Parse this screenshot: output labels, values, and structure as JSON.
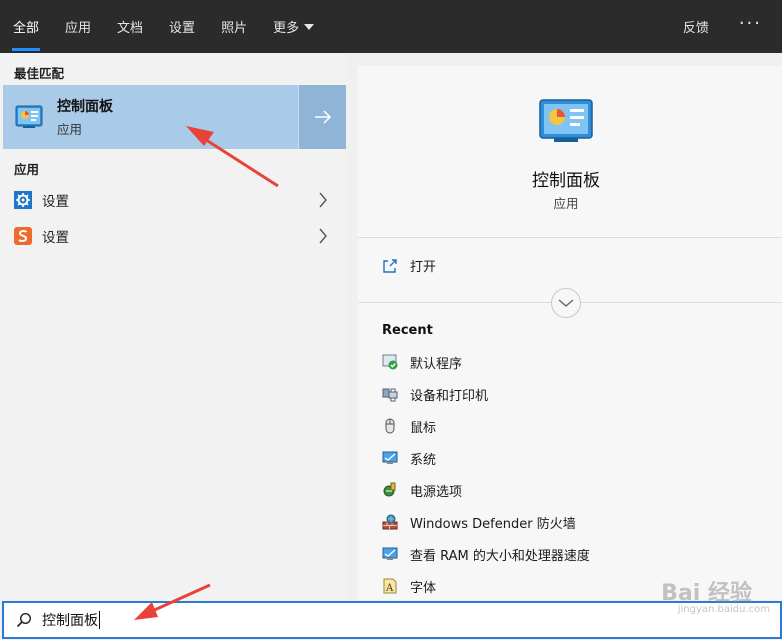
{
  "tabs": [
    {
      "label": "全部",
      "active": true
    },
    {
      "label": "应用"
    },
    {
      "label": "文档"
    },
    {
      "label": "设置"
    },
    {
      "label": "照片"
    },
    {
      "label": "更多"
    }
  ],
  "topbar": {
    "feedback": "反馈",
    "more": "···"
  },
  "left": {
    "best_match_label": "最佳匹配",
    "best_match": {
      "title": "控制面板",
      "subtitle": "应用"
    },
    "apps_label": "应用",
    "apps": [
      {
        "name": "设置",
        "icon": "gear-icon"
      },
      {
        "name": "设置",
        "icon": "sogou-icon"
      }
    ]
  },
  "right": {
    "title": "控制面板",
    "subtitle": "应用",
    "open_label": "打开",
    "recent_label": "Recent",
    "recent": [
      {
        "label": "默认程序",
        "icon": "default-programs-icon"
      },
      {
        "label": "设备和打印机",
        "icon": "printer-icon"
      },
      {
        "label": "鼠标",
        "icon": "mouse-icon"
      },
      {
        "label": "系统",
        "icon": "system-icon"
      },
      {
        "label": "电源选项",
        "icon": "power-icon"
      },
      {
        "label": "Windows Defender 防火墙",
        "icon": "firewall-icon"
      },
      {
        "label": "查看 RAM 的大小和处理器速度",
        "icon": "system-info-icon"
      },
      {
        "label": "字体",
        "icon": "font-icon"
      }
    ]
  },
  "search": {
    "query": "控制面板"
  },
  "watermark": {
    "brand": "Bai 经验",
    "url": "jingyan.baidu.com"
  },
  "colors": {
    "accent": "#1e90ff",
    "selected": "#a9cbe8",
    "topbar": "#2b2b2b",
    "annotation": "#e8423a"
  }
}
